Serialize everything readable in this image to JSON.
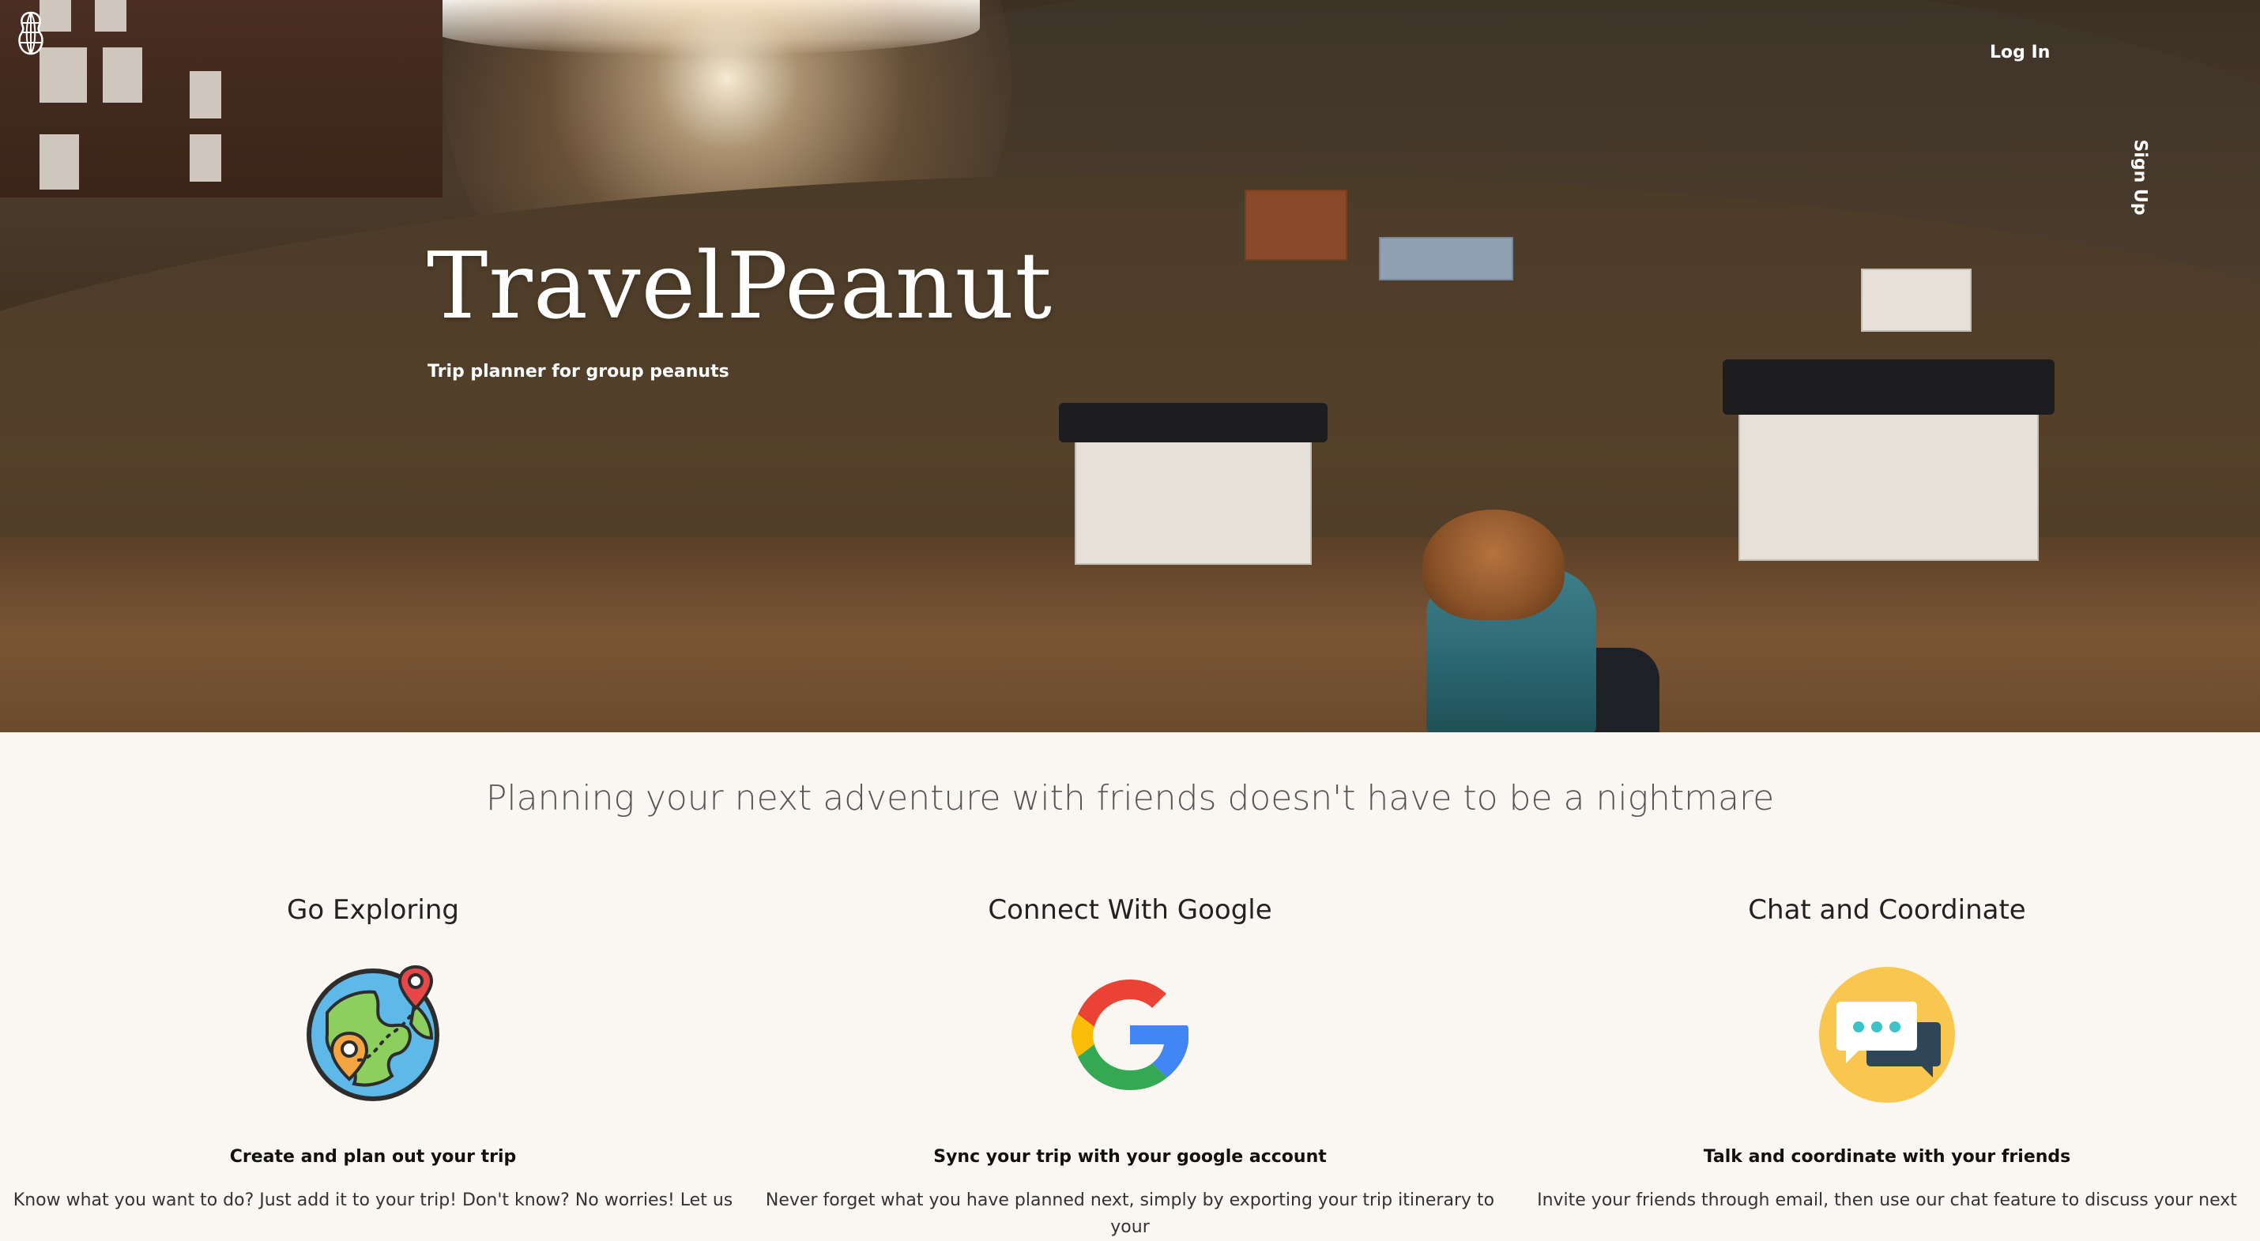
{
  "nav": {
    "logo_icon": "peanut-globe-icon",
    "login_label": "Log In",
    "signup_label": "Sign Up"
  },
  "hero": {
    "brand": "TravelPeanut",
    "tagline": "Trip planner for group peanuts"
  },
  "main": {
    "headline": "Planning your next adventure with friends doesn't have to be a nightmare",
    "features": [
      {
        "title": "Go Exploring",
        "icon": "globe-map-pins-icon",
        "subtitle": "Create and plan out your trip",
        "description": "Know what you want to do? Just add it to your trip! Don't know? No worries! Let us"
      },
      {
        "title": "Connect With Google",
        "icon": "google-g-icon",
        "subtitle": "Sync your trip with your google account",
        "description": "Never forget what you have planned next, simply by exporting your trip itinerary to your"
      },
      {
        "title": "Chat and Coordinate",
        "icon": "chat-bubbles-icon",
        "subtitle": "Talk and coordinate with your friends",
        "description": "Invite your friends through email, then use our chat feature to discuss your next"
      }
    ]
  },
  "colors": {
    "background": "#faf7f2",
    "chat_circle": "#f9c74f",
    "google_red": "#ea4335",
    "google_yellow": "#fbbc05",
    "google_green": "#34a853",
    "google_blue": "#4285f4"
  }
}
